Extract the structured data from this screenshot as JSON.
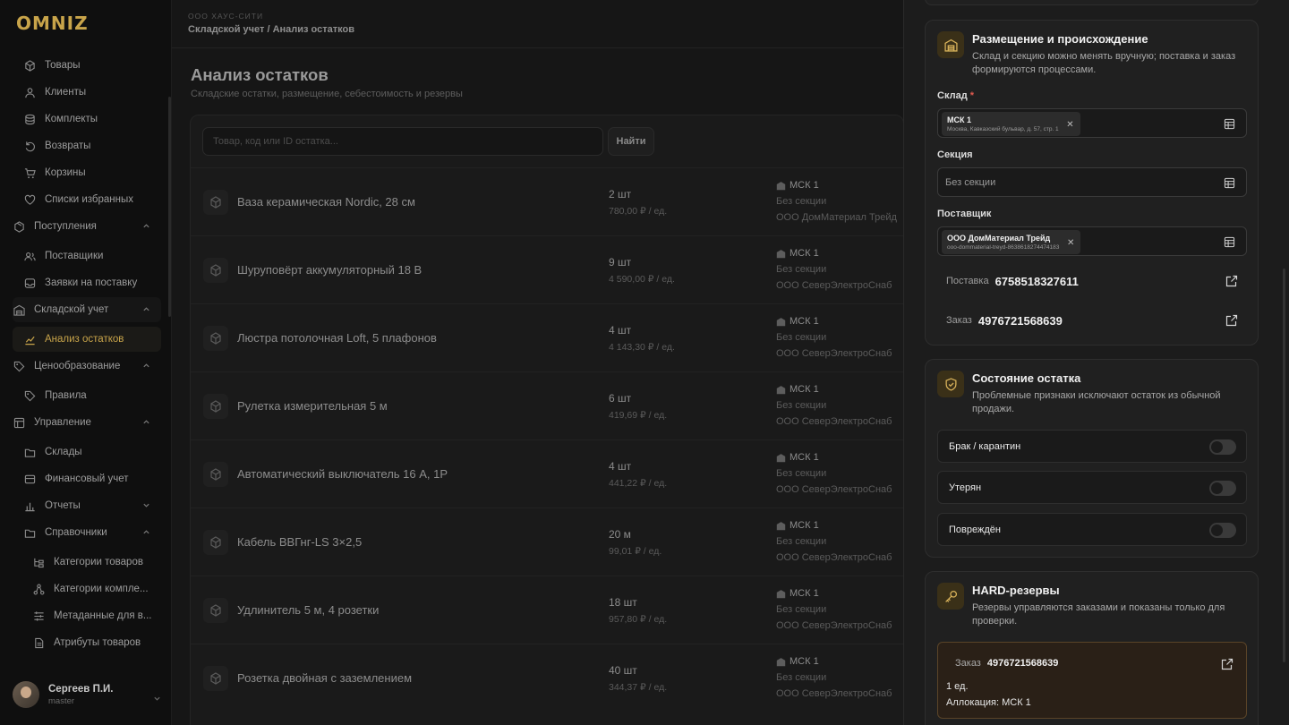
{
  "logo": "OMNIZ",
  "sidebar": {
    "items": [
      {
        "label": "Товары",
        "icon": "cube-icon"
      },
      {
        "label": "Клиенты",
        "icon": "person-icon"
      },
      {
        "label": "Комплекты",
        "icon": "layers-icon"
      },
      {
        "label": "Возвраты",
        "icon": "return-icon"
      },
      {
        "label": "Корзины",
        "icon": "cart-icon"
      },
      {
        "label": "Списки избранных",
        "icon": "heart-icon"
      },
      {
        "label": "Поступления",
        "icon": "package-icon",
        "group": true
      },
      {
        "label": "Поставщики",
        "icon": "people-icon"
      },
      {
        "label": "Заявки на поставку",
        "icon": "inbox-icon"
      },
      {
        "label": "Складской учет",
        "icon": "warehouse-icon",
        "group": true
      },
      {
        "label": "Анализ остатков",
        "icon": "chart-icon",
        "active": true
      },
      {
        "label": "Ценообразование",
        "icon": "tag-icon",
        "group": true
      },
      {
        "label": "Правила",
        "icon": "tag-icon"
      },
      {
        "label": "Управление",
        "icon": "layout-icon",
        "group": true
      },
      {
        "label": "Склады",
        "icon": "folder-icon"
      },
      {
        "label": "Финансовый учет",
        "icon": "wallet-icon"
      },
      {
        "label": "Отчеты",
        "icon": "bar-chart-icon",
        "group": true
      },
      {
        "label": "Справочники",
        "icon": "folder-icon",
        "group": true
      },
      {
        "label": "Категории товаров",
        "icon": "tree-icon"
      },
      {
        "label": "Категории компле...",
        "icon": "network-icon"
      },
      {
        "label": "Метаданные для в...",
        "icon": "list-icon"
      },
      {
        "label": "Атрибуты товаров",
        "icon": "doc-icon"
      }
    ],
    "user": {
      "name": "Сергеев П.И.",
      "role": "master"
    }
  },
  "header": {
    "org": "ООО ХАУС-СИТИ",
    "breadcrumb": "Складской учет / Анализ остатков"
  },
  "main": {
    "title": "Анализ остатков",
    "subtitle": "Складские остатки, размещение, себестоимость и резервы",
    "search_placeholder": "Товар, код или ID остатка...",
    "search_button": "Найти",
    "rows": [
      {
        "name": "Ваза керамическая Nordic, 28 см",
        "qty": "2 шт",
        "price": "780,00 ₽ / ед.",
        "warehouse": "МСК 1",
        "section": "Без секции",
        "supplier": "ООО ДомМатериал Трейд"
      },
      {
        "name": "Шуруповёрт аккумуляторный 18 В",
        "qty": "9 шт",
        "price": "4 590,00 ₽ / ед.",
        "warehouse": "МСК 1",
        "section": "Без секции",
        "supplier": "ООО СеверЭлектроСнаб"
      },
      {
        "name": "Люстра потолочная Loft, 5 плафонов",
        "qty": "4 шт",
        "price": "4 143,30 ₽ / ед.",
        "warehouse": "МСК 1",
        "section": "Без секции",
        "supplier": "ООО СеверЭлектроСнаб"
      },
      {
        "name": "Рулетка измерительная 5 м",
        "qty": "6 шт",
        "price": "419,69 ₽ / ед.",
        "warehouse": "МСК 1",
        "section": "Без секции",
        "supplier": "ООО СеверЭлектроСнаб"
      },
      {
        "name": "Автоматический выключатель 16 А, 1P",
        "qty": "4 шт",
        "price": "441,22 ₽ / ед.",
        "warehouse": "МСК 1",
        "section": "Без секции",
        "supplier": "ООО СеверЭлектроСнаб"
      },
      {
        "name": "Кабель ВВГнг-LS 3×2,5",
        "qty": "20 м",
        "price": "99,01 ₽ / ед.",
        "warehouse": "МСК 1",
        "section": "Без секции",
        "supplier": "ООО СеверЭлектроСнаб"
      },
      {
        "name": "Удлинитель 5 м, 4 розетки",
        "qty": "18 шт",
        "price": "957,80 ₽ / ед.",
        "warehouse": "МСК 1",
        "section": "Без секции",
        "supplier": "ООО СеверЭлектроСнаб"
      },
      {
        "name": "Розетка двойная с заземлением",
        "qty": "40 шт",
        "price": "344,37 ₽ / ед.",
        "warehouse": "МСК 1",
        "section": "Без секции",
        "supplier": "ООО СеверЭлектроСнаб"
      }
    ]
  },
  "drawer": {
    "placement": {
      "title": "Размещение и происхождение",
      "desc": "Склад и секцию можно менять вручную; поставка и заказ формируются процессами.",
      "warehouse_label": "Склад",
      "required_mark": "*",
      "warehouse_chip_title": "МСК 1",
      "warehouse_chip_sub": "Москва, Кавказский бульвар, д. 57, стр. 1",
      "section_label": "Секция",
      "section_placeholder": "Без секции",
      "supplier_label": "Поставщик",
      "supplier_chip_title": "ООО ДомМатериал Трейд",
      "supplier_chip_sub": "ooo-dommaterial-treyd-8638618274474183",
      "delivery_label": "Поставка",
      "delivery_value": "6758518327611",
      "order_label": "Заказ",
      "order_value": "4976721568639"
    },
    "state": {
      "title": "Состояние остатка",
      "desc": "Проблемные признаки исключают остаток из обычной продажи.",
      "toggles": [
        "Брак / карантин",
        "Утерян",
        "Повреждён"
      ]
    },
    "reserves": {
      "title": "HARD-резервы",
      "desc": "Резервы управляются заказами и показаны только для проверки.",
      "order_label": "Заказ",
      "order_value": "4976721568639",
      "qty": "1 ед.",
      "allocation": "Аллокация: МСК 1"
    }
  },
  "colors": {
    "accent": "#c8a44a",
    "bg": "#141414",
    "panel": "#1c1c1c"
  }
}
